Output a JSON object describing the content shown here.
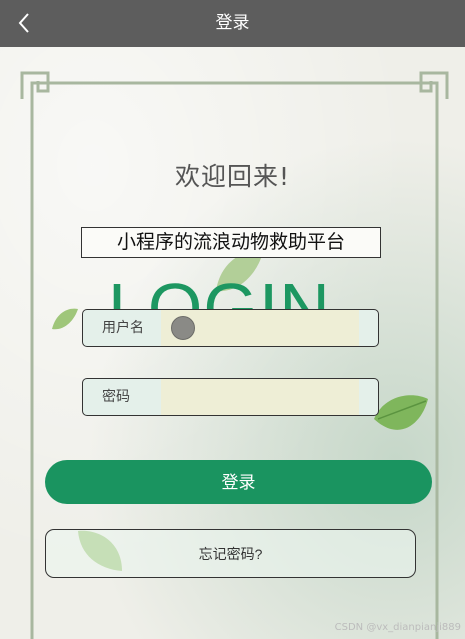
{
  "nav": {
    "title": "登录",
    "back_icon": "chevron-left-icon"
  },
  "welcome_title": "欢迎回来!",
  "platform_name": "小程序的流浪动物救助平台",
  "login_word": "LOGIN",
  "form": {
    "username_label": "用户名",
    "username_value": "",
    "password_label": "密码",
    "password_value": ""
  },
  "login_button": "登录",
  "forgot_button": "忘记密码?",
  "watermark": "CSDN @vx_dianpianji889",
  "colors": {
    "topbar": "#5d5d5d",
    "accent": "#1a9460",
    "login_text": "#1d9761"
  }
}
